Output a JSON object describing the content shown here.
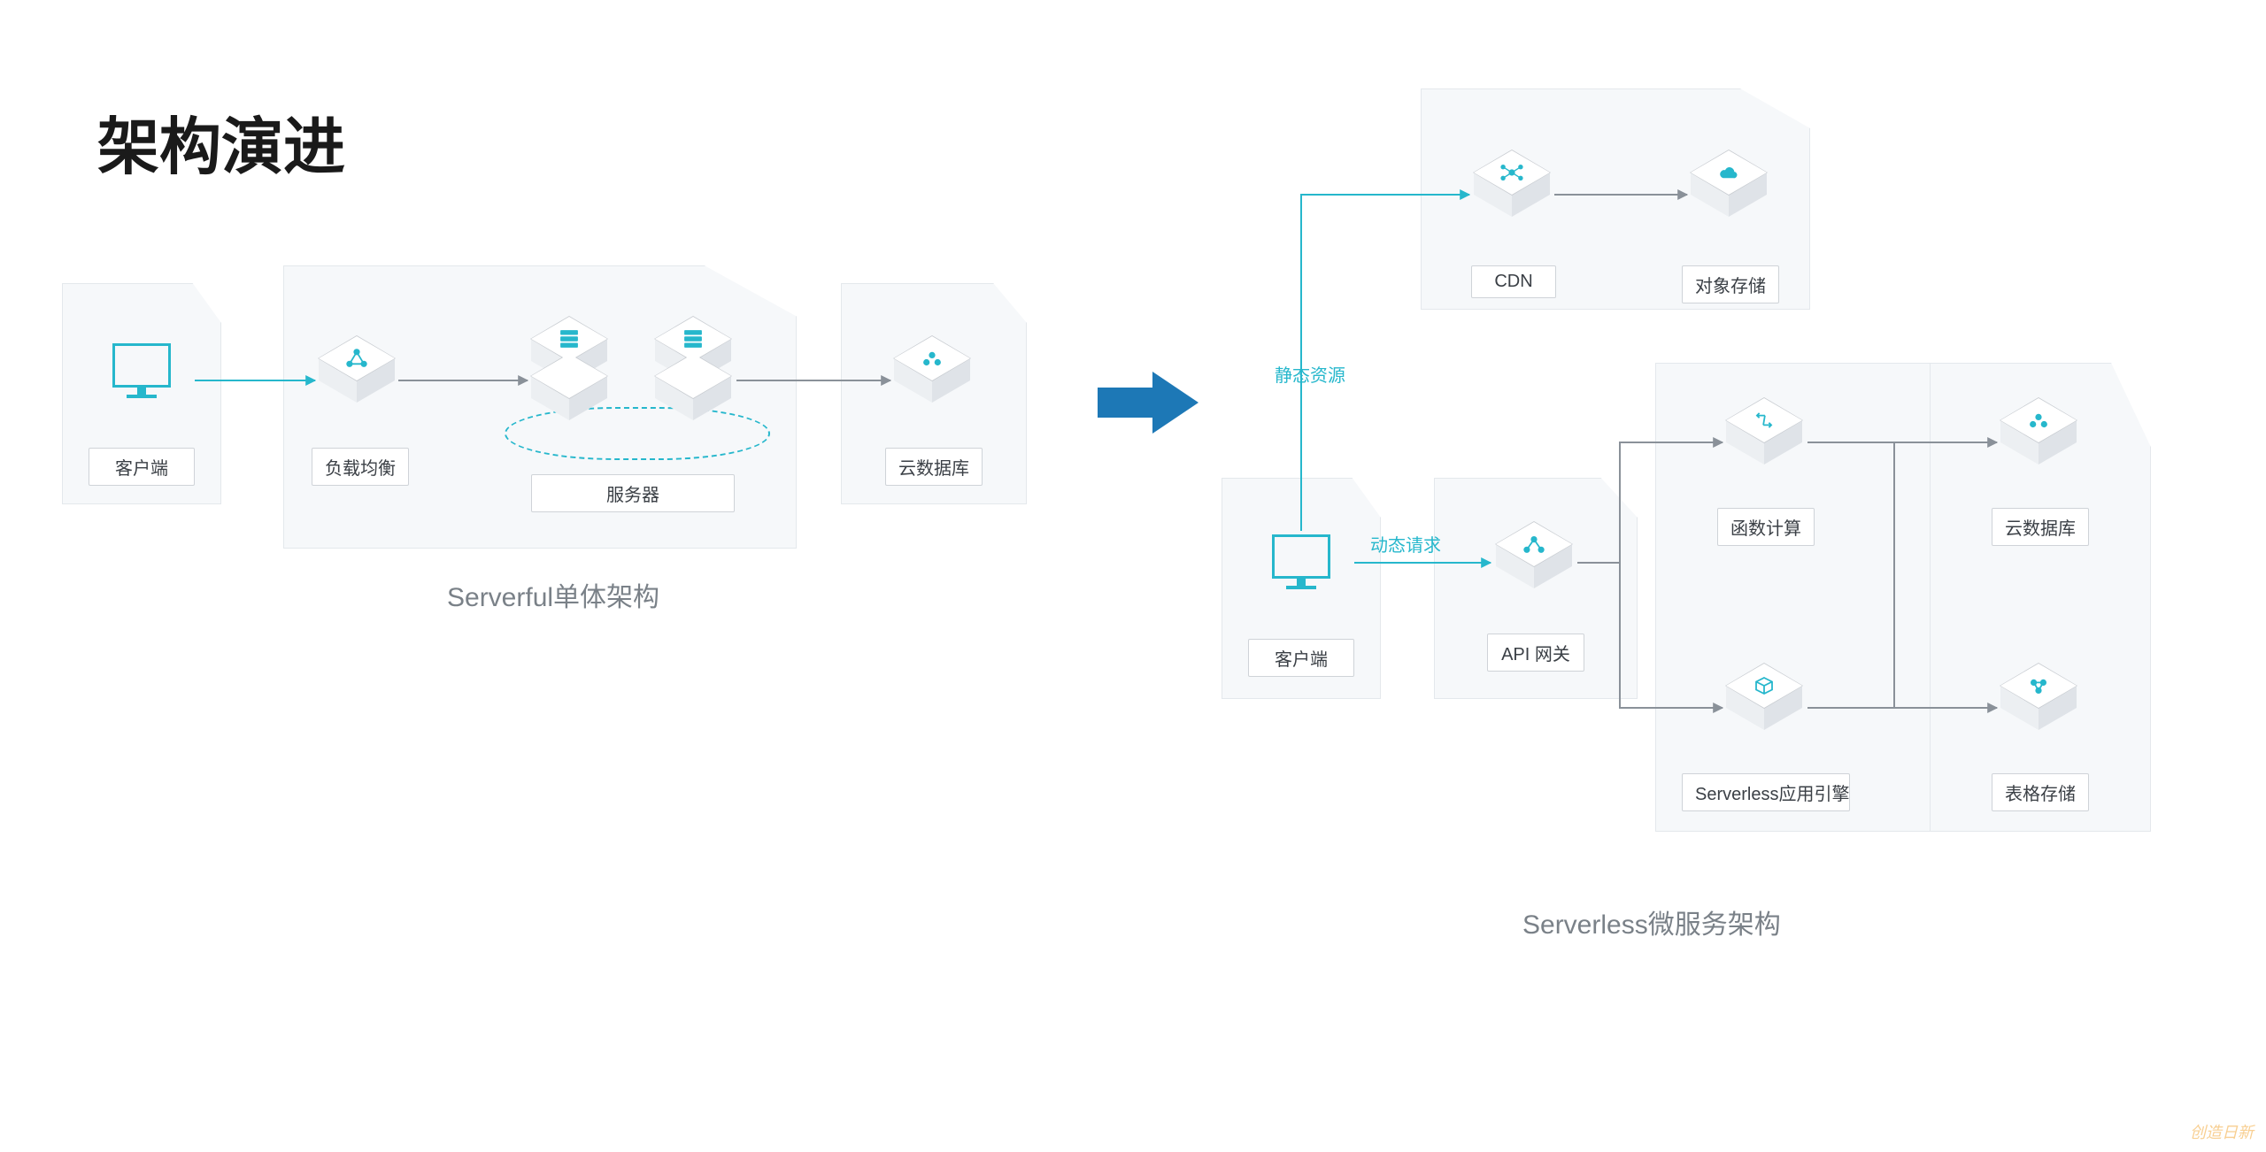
{
  "title": "架构演进",
  "left": {
    "subtitle": "Serverful单体架构",
    "client": "客户端",
    "lb": "负载均衡",
    "server": "服务器",
    "db": "云数据库"
  },
  "right": {
    "subtitle": "Serverless微服务架构",
    "client": "客户端",
    "cdn": "CDN",
    "oss": "对象存储",
    "api": "API 网关",
    "fc": "函数计算",
    "sae": "Serverless应用引擎",
    "rds": "云数据库",
    "ots": "表格存储",
    "static_label": "静态资源",
    "dynamic_label": "动态请求"
  },
  "watermark": "创造日新"
}
